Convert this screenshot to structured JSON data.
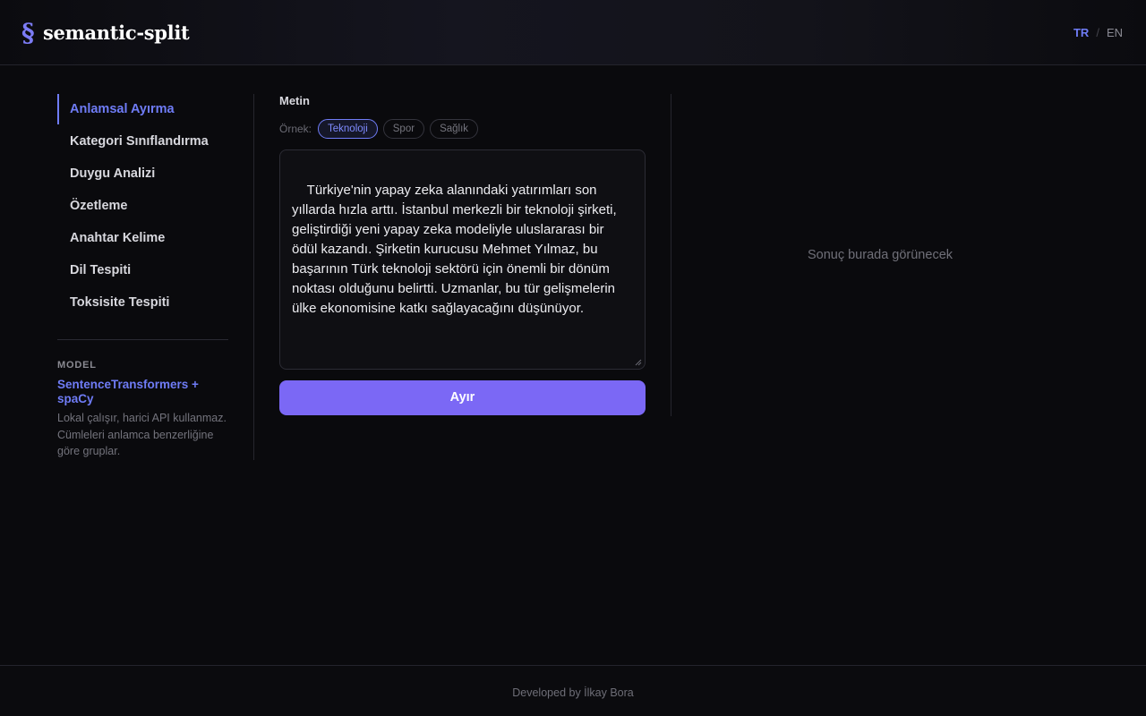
{
  "header": {
    "logo_mark": "§",
    "app_name": "semantic-split",
    "languages": {
      "active": "TR",
      "separator": "/",
      "inactive": "EN"
    }
  },
  "sidebar": {
    "items": [
      {
        "label": "Anlamsal Ayırma",
        "active": true
      },
      {
        "label": "Kategori Sınıflandırma"
      },
      {
        "label": "Duygu Analizi"
      },
      {
        "label": "Özetleme"
      },
      {
        "label": "Anahtar Kelime"
      },
      {
        "label": "Dil Tespiti"
      },
      {
        "label": "Toksisite Tespiti"
      }
    ],
    "model": {
      "label": "MODEL",
      "name": "SentenceTransformers + spaCy",
      "description": "Lokal çalışır, harici API kullanmaz. Cümleleri anlamca benzerliğine göre gruplar."
    }
  },
  "main": {
    "field_label": "Metin",
    "examples_label": "Örnek:",
    "examples": [
      "Teknoloji",
      "Spor",
      "Sağlık"
    ],
    "selected_example": "Teknoloji",
    "text_value": "Türkiye'nin yapay zeka alanındaki yatırımları son yıllarda hızla arttı. İstanbul merkezli bir teknoloji şirketi, geliştirdiği yeni yapay zeka modeliyle uluslararası bir ödül kazandı. Şirketin kurucusu Mehmet Yılmaz, bu başarının Türk teknoloji sektörü için önemli bir dönüm noktası olduğunu belirtti. Uzmanlar, bu tür gelişmelerin ülke ekonomisine katkı sağlayacağını düşünüyor.",
    "submit_label": "Ayır"
  },
  "result": {
    "placeholder": "Sonuç burada görünecek"
  },
  "footer": {
    "text": "Developed by İlkay Bora"
  },
  "colors": {
    "accent": "#6f7cf6",
    "button": "#7b68f5",
    "background": "#0a0a0d"
  }
}
